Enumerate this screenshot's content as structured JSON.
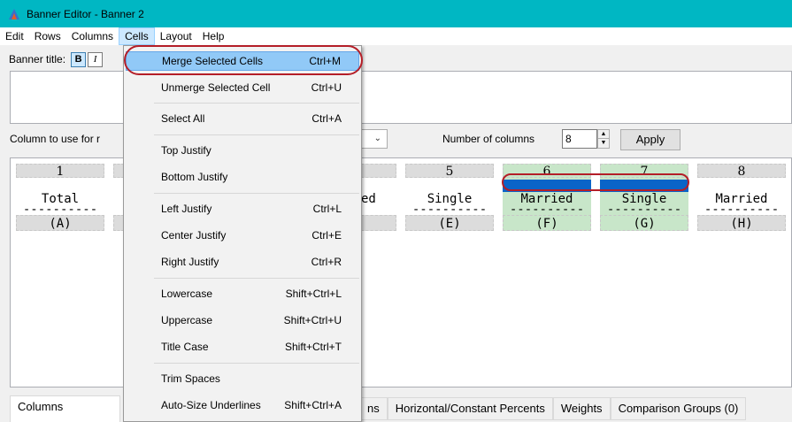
{
  "window": {
    "title": "Banner Editor - Banner 2"
  },
  "menubar": {
    "items": [
      {
        "label": "Edit"
      },
      {
        "label": "Rows"
      },
      {
        "label": "Columns"
      },
      {
        "label": "Cells"
      },
      {
        "label": "Layout"
      },
      {
        "label": "Help"
      }
    ]
  },
  "banner": {
    "title_label": "Banner title:",
    "bold_label": "B",
    "italic_label": "I"
  },
  "column_row": {
    "use_label": "Column to use for r",
    "numcols_label": "Number of columns",
    "numcols_value": "8",
    "apply_label": "Apply"
  },
  "grid": {
    "columns": [
      {
        "num": "1",
        "label": "Total",
        "underline": "----------",
        "letter": "(A)"
      },
      {
        "num": "5",
        "label": "Single",
        "underline": "----------",
        "letter": "(E)"
      },
      {
        "num": "6",
        "label": "Married",
        "underline": "----------",
        "letter": "(F)"
      },
      {
        "num": "7",
        "label": "Single",
        "underline": "----------",
        "letter": "(G)"
      },
      {
        "num": "8",
        "label": "Married",
        "underline": "----------",
        "letter": "(H)"
      }
    ],
    "partial_label": "ed"
  },
  "tabs": [
    {
      "label": "Columns"
    },
    {
      "label": "ns"
    },
    {
      "label": "Horizontal/Constant Percents"
    },
    {
      "label": "Weights"
    },
    {
      "label": "Comparison Groups (0)"
    }
  ],
  "cells_menu": {
    "items": [
      {
        "label": "Merge Selected Cells",
        "shortcut": "Ctrl+M"
      },
      {
        "label": "Unmerge Selected Cell",
        "shortcut": "Ctrl+U"
      },
      {
        "label": "Select All",
        "shortcut": "Ctrl+A"
      },
      {
        "label": "Top Justify",
        "shortcut": ""
      },
      {
        "label": "Bottom Justify",
        "shortcut": ""
      },
      {
        "label": "Left Justify",
        "shortcut": "Ctrl+L"
      },
      {
        "label": "Center Justify",
        "shortcut": "Ctrl+E"
      },
      {
        "label": "Right Justify",
        "shortcut": "Ctrl+R"
      },
      {
        "label": "Lowercase",
        "shortcut": "Shift+Ctrl+L"
      },
      {
        "label": "Uppercase",
        "shortcut": "Shift+Ctrl+U"
      },
      {
        "label": "Title Case",
        "shortcut": "Shift+Ctrl+T"
      },
      {
        "label": "Trim Spaces",
        "shortcut": ""
      },
      {
        "label": "Auto-Size Underlines",
        "shortcut": "Shift+Ctrl+A"
      }
    ]
  },
  "colors": {
    "titlebar": "#00b7c3",
    "highlight": "#91c9f7",
    "selected_cell": "#0a64c8",
    "selected_column": "#c8e6c9",
    "annotation": "#b41e28"
  }
}
